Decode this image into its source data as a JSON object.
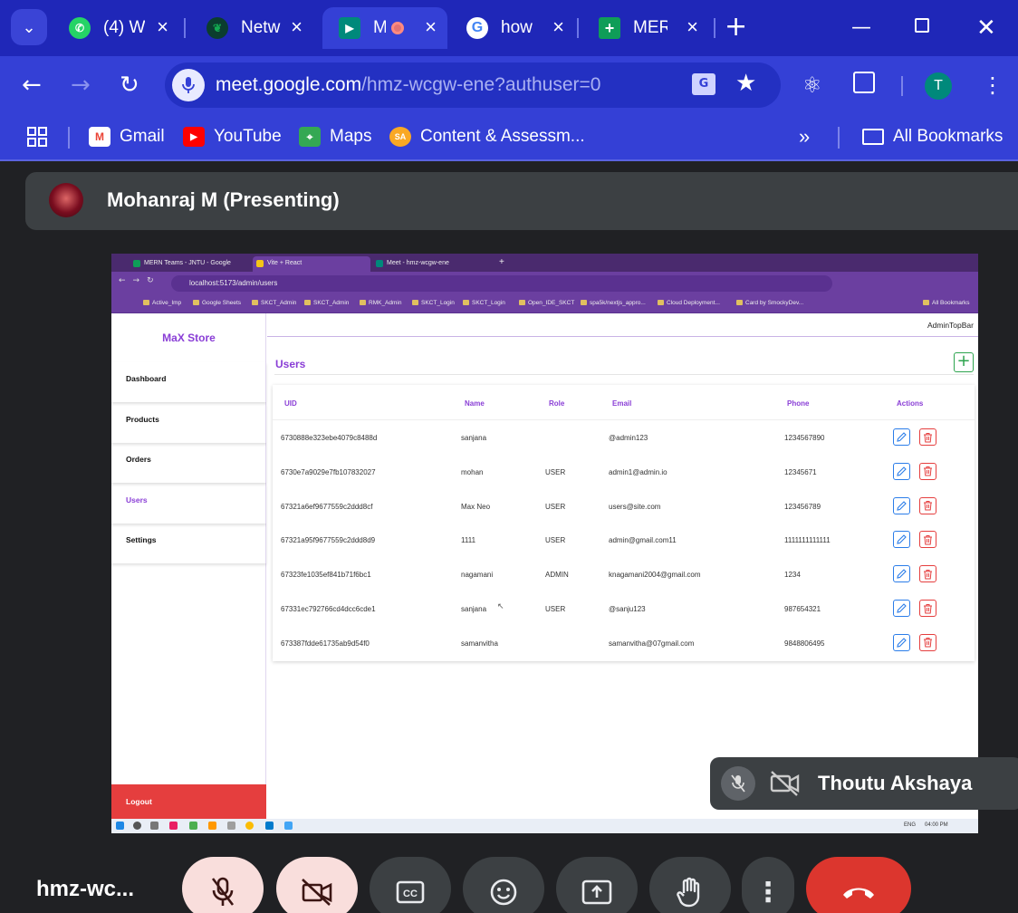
{
  "browser": {
    "tabs": [
      {
        "title": "(4) W",
        "icon": "whatsapp-icon",
        "color": "#25d366"
      },
      {
        "title": "Netw",
        "icon": "mongodb-leaf-icon",
        "color": "#13aa52"
      },
      {
        "title": "M",
        "icon": "google-meet-icon",
        "color": "#00897b"
      },
      {
        "title": "how",
        "icon": "google-icon",
        "color": "#ffffff"
      },
      {
        "title": "MERI",
        "icon": "google-sheets-icon",
        "color": "#0f9d58"
      }
    ],
    "url_host": "meet.google.com",
    "url_path": "/hmz-wcgw-ene?authuser=0",
    "profile_initial": "T",
    "bookmarks": [
      {
        "label": "Gmail",
        "icon": "gmail-icon"
      },
      {
        "label": "YouTube",
        "icon": "youtube-icon"
      },
      {
        "label": "Maps",
        "icon": "maps-icon"
      },
      {
        "label": "Content & Assessm...",
        "icon": "sa-icon"
      }
    ],
    "all_bookmarks": "All Bookmarks"
  },
  "meet": {
    "presenter": "Mohanraj M (Presenting)",
    "meeting_code": "hmz-wc...",
    "self_name": "Thoutu Akshaya"
  },
  "shared": {
    "tabs": [
      "MERN Teams - JNTU - Google",
      "Vite + React",
      "Meet - hmz-wcgw-ene"
    ],
    "url": "localhost:5173/admin/users",
    "bookmarks": [
      "Active_Imp",
      "Google Sheets",
      "SKCT_Admin",
      "SKCT_Admin",
      "RMK_Admin",
      "SKCT_Login",
      "SKCT_Login",
      "Open_IDE_SKCT",
      "spa5k/nextjs_appro...",
      "Cloud Deployment...",
      "Card by SmockyDev...",
      "All Bookmarks"
    ],
    "app": {
      "brand": "MaX Store",
      "nav": [
        "Dashboard",
        "Products",
        "Orders",
        "Users",
        "Settings"
      ],
      "logout": "Logout",
      "topbar": "AdminTopBar",
      "section_title": "Users",
      "columns": [
        "UID",
        "Name",
        "Role",
        "Email",
        "Phone",
        "Actions"
      ],
      "rows": [
        {
          "uid": "6730888e323ebe4079c8488d",
          "name": "sanjana",
          "role": "",
          "email": "@admin123",
          "phone": "1234567890"
        },
        {
          "uid": "6730e7a9029e7fb107832027",
          "name": "mohan",
          "role": "USER",
          "email": "admin1@admin.io",
          "phone": "12345671"
        },
        {
          "uid": "67321a6ef9677559c2ddd8cf",
          "name": "Max Neo",
          "role": "USER",
          "email": "users@site.com",
          "phone": "123456789"
        },
        {
          "uid": "67321a95f9677559c2ddd8d9",
          "name": "1111",
          "role": "USER",
          "email": "admin@gmail.com11",
          "phone": "1111111111111"
        },
        {
          "uid": "67323fe1035ef841b71f6bc1",
          "name": "nagamani",
          "role": "ADMIN",
          "email": "knagamani2004@gmail.com",
          "phone": "1234"
        },
        {
          "uid": "67331ec792766cd4dcc6cde1",
          "name": "sanjana",
          "role": "USER",
          "email": "@sanju123",
          "phone": "987654321"
        },
        {
          "uid": "673387fdde61735ab9d54f0",
          "name": "samanvitha",
          "role": "",
          "email": "samanvitha@07gmail.com",
          "phone": "9848806495"
        }
      ]
    },
    "taskbar": {
      "lang": "ENG",
      "time": "04:00 PM"
    }
  },
  "colors": {
    "chrome": "#1f27b8",
    "accent": "#8a3ed6",
    "danger": "#e53e3e",
    "edit": "#2b7de9"
  }
}
